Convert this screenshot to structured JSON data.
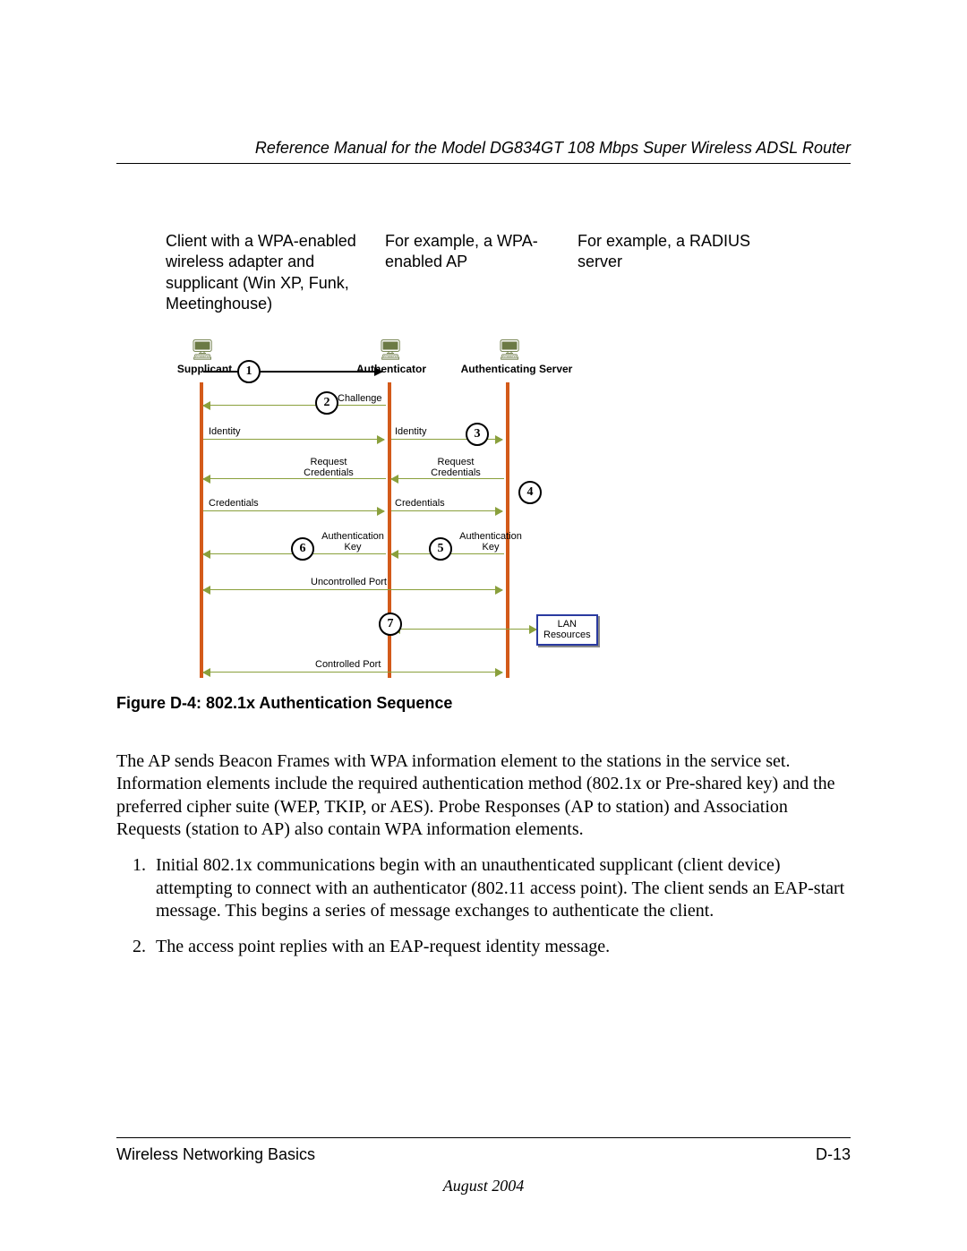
{
  "header": {
    "title": "Reference Manual for the Model DG834GT 108 Mbps Super Wireless ADSL Router"
  },
  "captions": {
    "client": "Client with a WPA-enabled wireless adapter and supplicant (Win XP, Funk, Meetinghouse)",
    "ap": "For example, a WPA-enabled AP",
    "server": "For example, a RADIUS server"
  },
  "diagram": {
    "nodes": {
      "supplicant": "Supplicant",
      "authenticator": "Authenticator",
      "auth_server": "Authenticating Server"
    },
    "steps": {
      "n1": "1",
      "n2": "2",
      "n3": "3",
      "n4": "4",
      "n5": "5",
      "n6": "6",
      "n7": "7"
    },
    "labels": {
      "challenge": "Challenge",
      "identity_l": "Identity",
      "identity_r": "Identity",
      "req_cred_l": "Request\nCredentials",
      "req_cred_r": "Request\nCredentials",
      "cred_l": "Credentials",
      "cred_r": "Credentials",
      "authkey_l": "Authentication\nKey",
      "authkey_r": "Authentication\nKey",
      "uncontrolled": "Uncontrolled Port",
      "controlled": "Controlled Port",
      "lan": "LAN\nResources"
    }
  },
  "figure_caption": "Figure D-4:  802.1x Authentication Sequence",
  "body": {
    "para": "The AP sends Beacon Frames with WPA information element to the stations in the service set. Information elements include the required authentication method (802.1x or Pre-shared key) and the preferred cipher suite (WEP, TKIP, or AES). Probe Responses (AP to station) and Association Requests (station to AP) also contain WPA information elements.",
    "list": [
      "Initial 802.1x communications begin with an unauthenticated supplicant (client device) attempting to connect with an authenticator (802.11 access point). The client sends an EAP-start message. This begins a series of message exchanges to authenticate the client.",
      "The access point replies with an EAP-request identity message."
    ]
  },
  "footer": {
    "section": "Wireless Networking Basics",
    "page": "D-13",
    "date": "August 2004"
  }
}
